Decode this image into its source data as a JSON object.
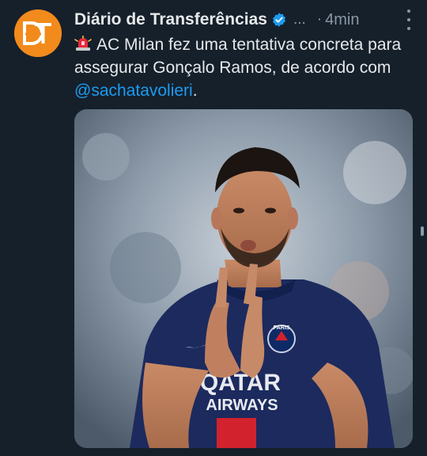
{
  "tweet": {
    "author_name": "Diário de Transferências",
    "handle_truncated": "...",
    "time_separator": "·",
    "time": "4min",
    "text_main": "AC Milan fez uma tentativa concreta para assegurar Gonçalo Ramos, de acordo com ",
    "mention": "@sachatavolieri",
    "text_end": ".",
    "media_jersey_sponsor_line1": "QATAR",
    "media_jersey_sponsor_line2": "AIRWAYS",
    "media_jersey_badge": "PARIS"
  },
  "colors": {
    "background": "#15202b",
    "accent": "#1d9bf0",
    "avatar_bg": "#f28a1c",
    "muted": "#8b98a5"
  },
  "icons": {
    "avatar": "dt-logo",
    "verified": "verified-badge-icon",
    "siren": "police-car-light-emoji",
    "more": "more-options-icon"
  }
}
